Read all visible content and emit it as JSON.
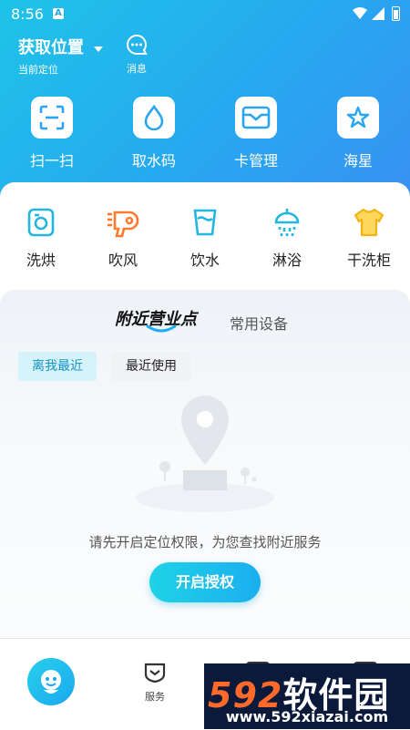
{
  "status": {
    "time": "8:56",
    "badge": "A"
  },
  "header": {
    "location_title": "获取位置",
    "location_sub": "当前定位",
    "messages_label": "消息"
  },
  "quick_actions": [
    {
      "label": "扫一扫",
      "icon": "scan-icon"
    },
    {
      "label": "取水码",
      "icon": "water-drop-icon"
    },
    {
      "label": "卡管理",
      "icon": "card-icon"
    },
    {
      "label": "海星",
      "icon": "star-icon"
    }
  ],
  "services": [
    {
      "label": "洗烘",
      "icon": "washer-icon"
    },
    {
      "label": "吹风",
      "icon": "hairdryer-icon"
    },
    {
      "label": "饮水",
      "icon": "water-cup-icon"
    },
    {
      "label": "淋浴",
      "icon": "shower-icon"
    },
    {
      "label": "干洗柜",
      "icon": "shirt-icon"
    }
  ],
  "tabs": {
    "active": "附近营业点",
    "inactive": "常用设备"
  },
  "filters": {
    "nearest": "离我最近",
    "recent": "最近使用"
  },
  "empty_state": {
    "message": "请先开启定位权限，为您查找附近服务",
    "button": "开启授权"
  },
  "bottom_nav": {
    "service_label": "服务"
  },
  "watermark": {
    "brand_digits": "592",
    "brand_text": "软件园",
    "url": "www.592xiazai.com"
  },
  "colors": {
    "primary": "#27a8f0",
    "accent": "#1fd3e6",
    "orange": "#ff7a2e",
    "yellow": "#f7c325"
  }
}
